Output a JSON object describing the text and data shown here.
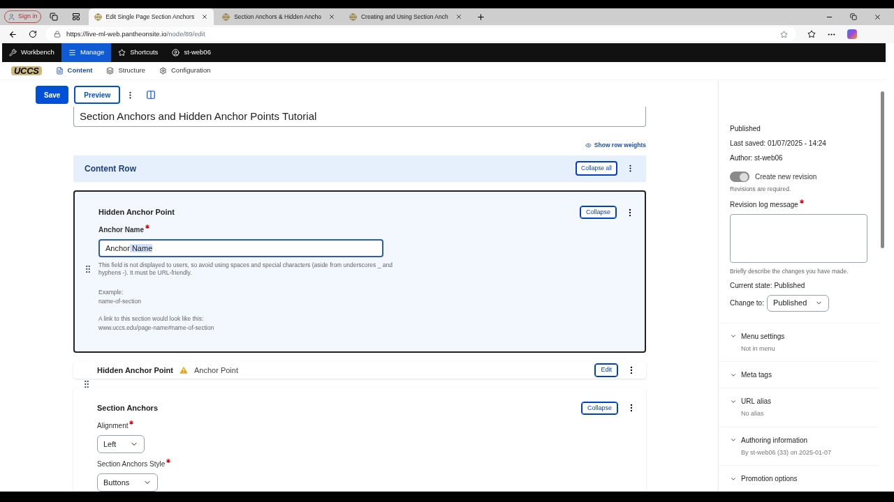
{
  "browser": {
    "sign_in": "Sign in",
    "tabs": [
      {
        "title": "Edit Single Page Section Anchors",
        "selected": true
      },
      {
        "title": "Section Anchors & Hidden Ancho",
        "selected": false
      },
      {
        "title": "Creating and Using Section Anch",
        "selected": false
      }
    ],
    "url_host": "https://live-ml-web.pantheonsite.io",
    "url_path": "/node/89/edit"
  },
  "toolbar": {
    "items": [
      {
        "label": "Workbench",
        "selected": false
      },
      {
        "label": "Manage",
        "selected": true
      },
      {
        "label": "Shortcuts",
        "selected": false
      },
      {
        "label": "st-web06",
        "selected": false
      }
    ]
  },
  "nav": {
    "logo": "UCCS",
    "items": [
      {
        "label": "Content",
        "selected": true
      },
      {
        "label": "Structure",
        "selected": false
      },
      {
        "label": "Configuration",
        "selected": false
      }
    ]
  },
  "actions": {
    "save": "Save",
    "preview": "Preview"
  },
  "title_value": "Section Anchors and Hidden Anchor Points Tutorial",
  "show_row_weights": "Show row weights",
  "content_row": {
    "title": "Content Row",
    "collapse_all": "Collapse all"
  },
  "paragraphs": [
    {
      "kind": "form",
      "title": "Hidden Anchor Point",
      "button": "Collapse",
      "focused": true,
      "field_label": "Anchor Name",
      "required": true,
      "value": "Anchor",
      "value_selected": " Name",
      "description": "This field is not displayed to users, so avoid using spaces and special characters (aside from underscores _ and hyphens -). It must be URL-friendly.",
      "example_label": "Example:",
      "example": "name-of-section",
      "link_label": "A link to this section would look like this:",
      "link_example": "www.uccs.edu/page-name#name-of-section"
    },
    {
      "kind": "summary",
      "title": "Hidden Anchor Point",
      "warning": true,
      "summary": "Anchor Point",
      "button": "Edit"
    },
    {
      "kind": "selects",
      "title": "Section Anchors",
      "button": "Collapse",
      "fields": [
        {
          "label": "Alignment",
          "required": true,
          "value": "Left"
        },
        {
          "label": "Section Anchors Style",
          "required": true,
          "value": "Buttons"
        }
      ]
    }
  ],
  "sidebar": {
    "status": "Published",
    "last_saved_label": "Last saved:",
    "last_saved": "01/07/2025 - 14:24",
    "author_label": "Author:",
    "author": "st-web06",
    "revision": {
      "label": "Create new revision",
      "on": true,
      "note": "Revisions are required."
    },
    "log_label": "Revision log message",
    "log_required": true,
    "log_description": "Briefly describe the changes you have made.",
    "current_state_label": "Current state:",
    "current_state": "Published",
    "change_to_label": "Change to:",
    "change_to": "Published",
    "sections": [
      {
        "title": "Menu settings",
        "summary": "Not in menu"
      },
      {
        "title": "Meta tags"
      },
      {
        "title": "URL alias",
        "summary": "No alias"
      },
      {
        "title": "Authoring information",
        "summary": "By st-web06 (33) on 2025-01-07"
      },
      {
        "title": "Promotion options"
      }
    ]
  }
}
